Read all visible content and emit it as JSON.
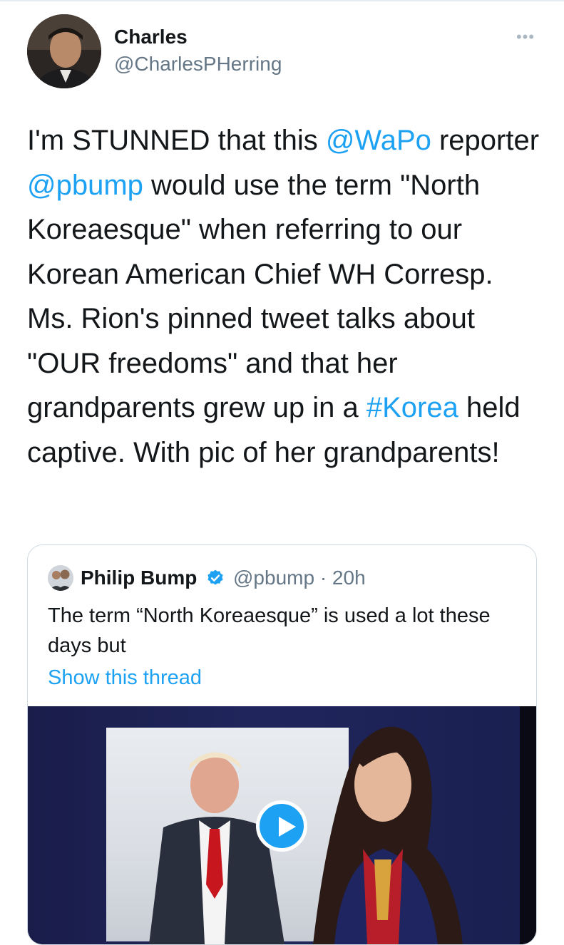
{
  "tweet": {
    "author_name": "Charles",
    "author_handle": "@CharlesPHerring",
    "more_icon": "more-dots-icon",
    "text_segments": [
      {
        "text": "I'm STUNNED that this ",
        "link": false
      },
      {
        "text": "@WaPo",
        "link": true
      },
      {
        "text": " reporter ",
        "link": false
      },
      {
        "text": "@pbump",
        "link": true
      },
      {
        "text": " would use the term \"North Koreaesque\" when referring to our Korean American Chief WH Corresp. Ms. Rion's pinned tweet talks about \"OUR freedoms\" and that her grandparents grew up in a ",
        "link": false
      },
      {
        "text": "#Korea",
        "link": true
      },
      {
        "text": " held captive. With pic of her grandparents!",
        "link": false
      }
    ]
  },
  "quote": {
    "author_name": "Philip Bump",
    "verified_icon": "verified-badge-icon",
    "handle_time": "@pbump · 20h",
    "text": "The term “North Koreaesque” is used a lot these days but",
    "show_thread": "Show this thread",
    "media": {
      "type": "video",
      "play_icon": "play-icon"
    }
  },
  "colors": {
    "link": "#1da1f2",
    "text": "#14171a",
    "secondary": "#657786",
    "border": "#cfd9de"
  }
}
